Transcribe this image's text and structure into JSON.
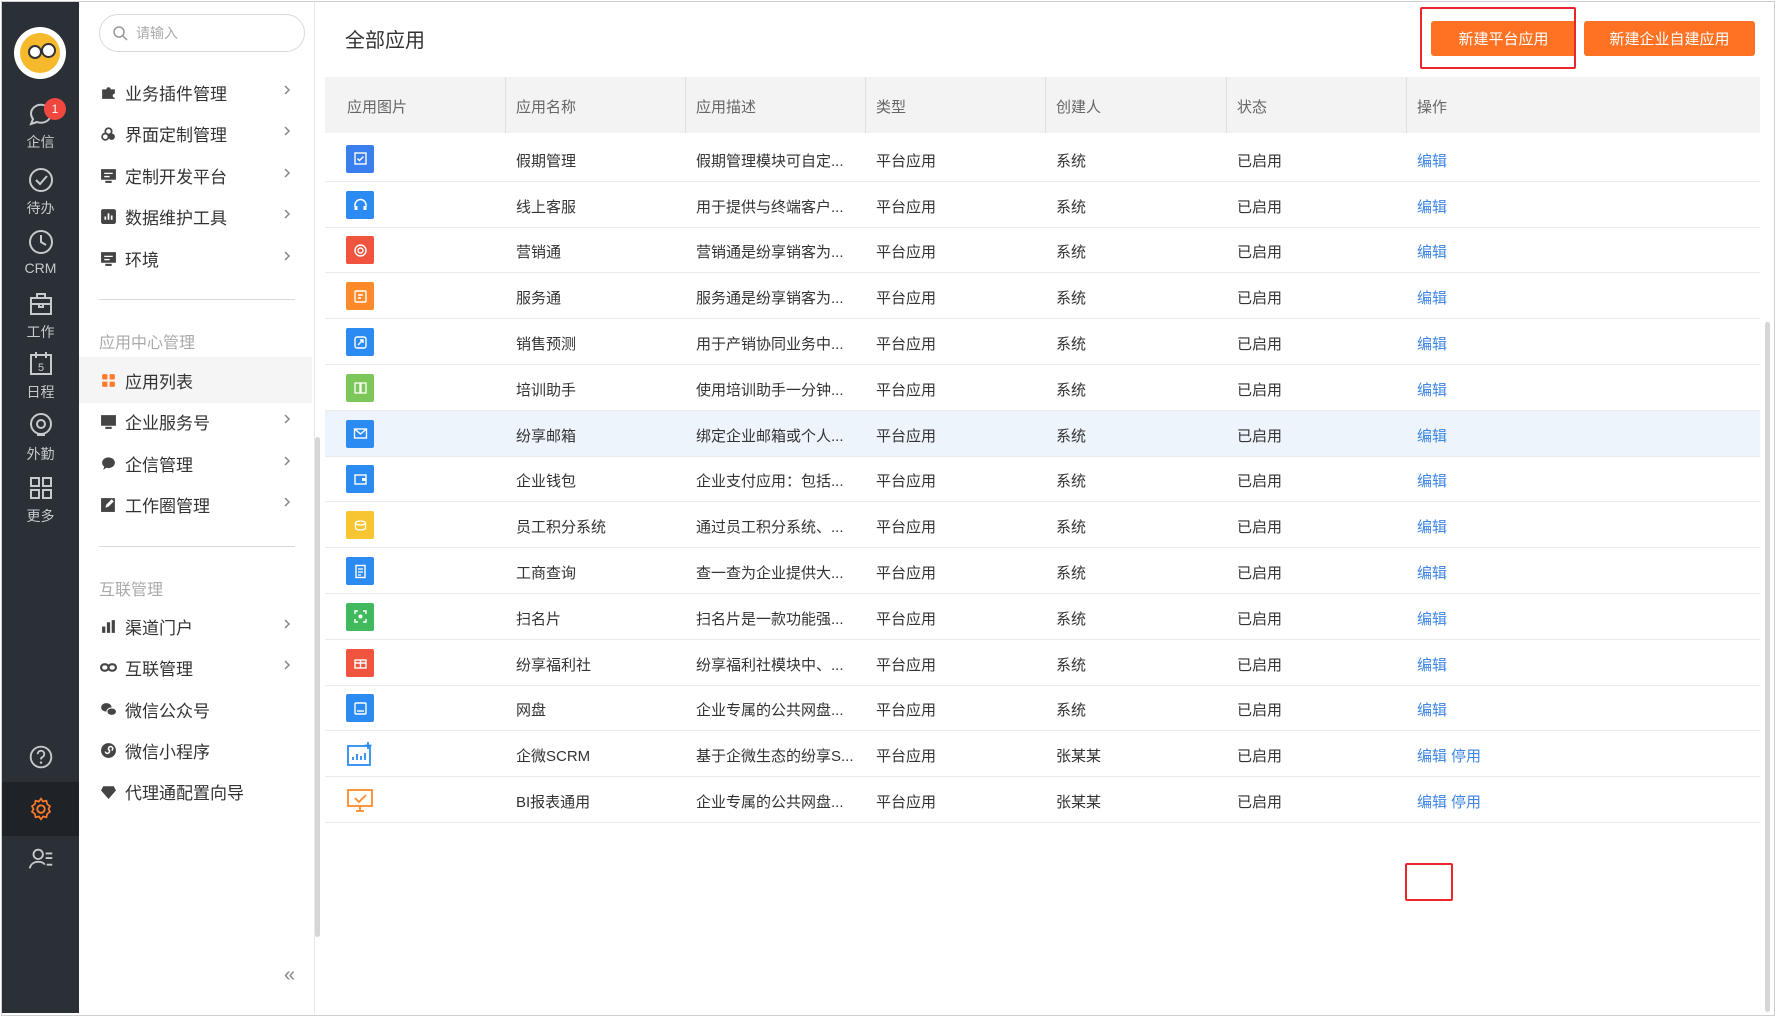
{
  "rail": {
    "items": [
      {
        "label": "企信",
        "icon": "chat-icon",
        "badge": "1"
      },
      {
        "label": "待办",
        "icon": "check-circle-icon"
      },
      {
        "label": "CRM",
        "icon": "clock-icon"
      },
      {
        "label": "工作",
        "icon": "briefcase-icon"
      },
      {
        "label": "日程",
        "icon": "calendar-icon"
      },
      {
        "label": "外勤",
        "icon": "location-icon"
      },
      {
        "label": "更多",
        "icon": "grid-icon"
      }
    ],
    "calendar_day": "5"
  },
  "sidebar": {
    "search_placeholder": "请输入",
    "items_top": [
      {
        "label": "业务插件管理",
        "icon": "puzzle-icon"
      },
      {
        "label": "界面定制管理",
        "icon": "palette-icon"
      },
      {
        "label": "定制开发平台",
        "icon": "monitor-icon"
      },
      {
        "label": "数据维护工具",
        "icon": "chart-box-icon"
      },
      {
        "label": "环境",
        "icon": "monitor-icon"
      }
    ],
    "group_app_center": "应用中心管理",
    "items_app_center": [
      {
        "label": "应用列表",
        "icon": "apps-icon"
      },
      {
        "label": "企业服务号",
        "icon": "monitor-icon"
      },
      {
        "label": "企信管理",
        "icon": "chat-bubble-icon"
      },
      {
        "label": "工作圈管理",
        "icon": "edit-icon"
      }
    ],
    "group_interconnect": "互联管理",
    "items_interconnect": [
      {
        "label": "渠道门户",
        "icon": "bar-chart-icon"
      },
      {
        "label": "互联管理",
        "icon": "link-icon"
      },
      {
        "label": "微信公众号",
        "icon": "wechat-icon"
      },
      {
        "label": "微信小程序",
        "icon": "miniprogram-icon"
      },
      {
        "label": "代理通配置向导",
        "icon": "gem-icon"
      }
    ],
    "collapse_glyph": "«"
  },
  "main": {
    "title": "全部应用",
    "btn_new_platform": "新建平台应用",
    "btn_new_enterprise": "新建企业自建应用",
    "columns": [
      "应用图片",
      "应用名称",
      "应用描述",
      "类型",
      "创建人",
      "状态",
      "操作"
    ],
    "rows": [
      {
        "name": "假期管理",
        "desc": "假期管理模块可自定...",
        "type": "平台应用",
        "creator": "系统",
        "status": "已启用",
        "actions": [
          "编辑"
        ],
        "icon_color": "#3a7ff0",
        "icon": "checkbox-icon"
      },
      {
        "name": "线上客服",
        "desc": "用于提供与终端客户...",
        "type": "平台应用",
        "creator": "系统",
        "status": "已启用",
        "actions": [
          "编辑"
        ],
        "icon_color": "#2b8bf2",
        "icon": "headset-icon"
      },
      {
        "name": "营销通",
        "desc": "营销通是纷享销客为...",
        "type": "平台应用",
        "creator": "系统",
        "status": "已启用",
        "actions": [
          "编辑"
        ],
        "icon_color": "#f0533e",
        "icon": "target-icon"
      },
      {
        "name": "服务通",
        "desc": "服务通是纷享销客为...",
        "type": "平台应用",
        "creator": "系统",
        "status": "已启用",
        "actions": [
          "编辑"
        ],
        "icon_color": "#ff8a2a",
        "icon": "service-icon"
      },
      {
        "name": "销售预测",
        "desc": "用于产销协同业务中...",
        "type": "平台应用",
        "creator": "系统",
        "status": "已启用",
        "actions": [
          "编辑"
        ],
        "icon_color": "#2b8bf2",
        "icon": "forecast-icon"
      },
      {
        "name": "培训助手",
        "desc": "使用培训助手一分钟...",
        "type": "平台应用",
        "creator": "系统",
        "status": "已启用",
        "actions": [
          "编辑"
        ],
        "icon_color": "#7cc65a",
        "icon": "book-icon"
      },
      {
        "name": "纷享邮箱",
        "desc": "绑定企业邮箱或个人...",
        "type": "平台应用",
        "creator": "系统",
        "status": "已启用",
        "actions": [
          "编辑"
        ],
        "icon_color": "#2b8bf2",
        "icon": "mail-icon"
      },
      {
        "name": "企业钱包",
        "desc": "企业支付应用：包括...",
        "type": "平台应用",
        "creator": "系统",
        "status": "已启用",
        "actions": [
          "编辑"
        ],
        "icon_color": "#2b8bf2",
        "icon": "wallet-icon"
      },
      {
        "name": "员工积分系统",
        "desc": "通过员工积分系统、...",
        "type": "平台应用",
        "creator": "系统",
        "status": "已启用",
        "actions": [
          "编辑"
        ],
        "icon_color": "#f7c531",
        "icon": "coins-icon"
      },
      {
        "name": "工商查询",
        "desc": "查一查为企业提供大...",
        "type": "平台应用",
        "creator": "系统",
        "status": "已启用",
        "actions": [
          "编辑"
        ],
        "icon_color": "#2b8bf2",
        "icon": "document-icon"
      },
      {
        "name": "扫名片",
        "desc": "扫名片是一款功能强...",
        "type": "平台应用",
        "creator": "系统",
        "status": "已启用",
        "actions": [
          "编辑"
        ],
        "icon_color": "#42b95c",
        "icon": "scan-icon"
      },
      {
        "name": "纷享福利社",
        "desc": "纷享福利社模块中、...",
        "type": "平台应用",
        "creator": "系统",
        "status": "已启用",
        "actions": [
          "编辑"
        ],
        "icon_color": "#f0533e",
        "icon": "gift-icon"
      },
      {
        "name": "网盘",
        "desc": "企业专属的公共网盘...",
        "type": "平台应用",
        "creator": "系统",
        "status": "已启用",
        "actions": [
          "编辑"
        ],
        "icon_color": "#2b8bf2",
        "icon": "disk-icon"
      },
      {
        "name": "企微SCRM",
        "desc": "基于企微生态的纷享S...",
        "type": "平台应用",
        "creator": "张某某",
        "status": "已启用",
        "actions": [
          "编辑",
          "停用"
        ],
        "icon_color": "#2b8bf2",
        "icon": "scrm-chart-icon",
        "outline": true
      },
      {
        "name": "BI报表通用",
        "desc": "企业专属的公共网盘...",
        "type": "平台应用",
        "creator": "张某某",
        "status": "已启用",
        "actions": [
          "编辑",
          "停用"
        ],
        "icon_color": "#ff8a2a",
        "icon": "bi-monitor-icon",
        "outline": true
      }
    ]
  },
  "colors": {
    "accent": "#ff7123",
    "link": "#3e86e6",
    "highlight_box": "#e8262b",
    "rail_bg": "#2b3036"
  }
}
